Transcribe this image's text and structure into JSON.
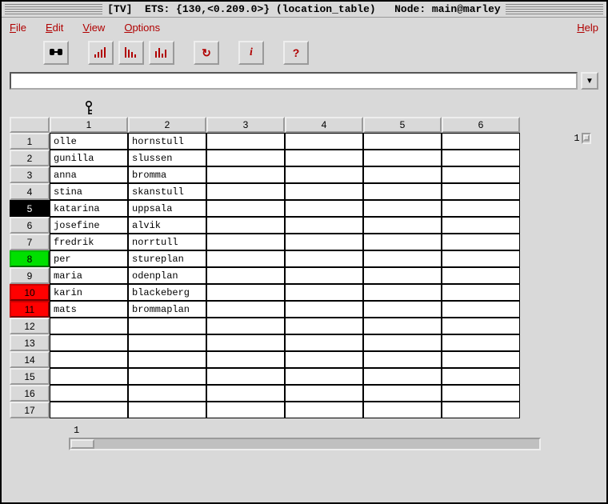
{
  "title": "[TV]  ETS: {130,<0.209.0>} (location_table)   Node: main@marley",
  "menu": {
    "file": "File",
    "edit": "Edit",
    "view": "View",
    "options": "Options",
    "help": "Help"
  },
  "toolbar": {
    "search": "search",
    "sort1": "sort-asc",
    "sort2": "sort-desc",
    "sort3": "sort-none",
    "refresh": "refresh",
    "info": "info",
    "question": "help"
  },
  "entry_value": "",
  "key_column_index": 1,
  "columns": [
    "1",
    "2",
    "3",
    "4",
    "5",
    "6"
  ],
  "rows": [
    {
      "n": "1",
      "style": "",
      "c": [
        "olle",
        "hornstull",
        "",
        "",
        "",
        ""
      ]
    },
    {
      "n": "2",
      "style": "",
      "c": [
        "gunilla",
        "slussen",
        "",
        "",
        "",
        ""
      ]
    },
    {
      "n": "3",
      "style": "",
      "c": [
        "anna",
        "bromma",
        "",
        "",
        "",
        ""
      ]
    },
    {
      "n": "4",
      "style": "",
      "c": [
        "stina",
        "skanstull",
        "",
        "",
        "",
        ""
      ]
    },
    {
      "n": "5",
      "style": "black",
      "c": [
        "katarina",
        "uppsala",
        "",
        "",
        "",
        ""
      ]
    },
    {
      "n": "6",
      "style": "",
      "c": [
        "josefine",
        "alvik",
        "",
        "",
        "",
        ""
      ]
    },
    {
      "n": "7",
      "style": "",
      "c": [
        "fredrik",
        "norrtull",
        "",
        "",
        "",
        ""
      ]
    },
    {
      "n": "8",
      "style": "green",
      "c": [
        "per",
        "stureplan",
        "",
        "",
        "",
        ""
      ]
    },
    {
      "n": "9",
      "style": "",
      "c": [
        "maria",
        "odenplan",
        "",
        "",
        "",
        ""
      ]
    },
    {
      "n": "10",
      "style": "red",
      "c": [
        "karin",
        "blackeberg",
        "",
        "",
        "",
        ""
      ]
    },
    {
      "n": "11",
      "style": "red",
      "c": [
        "mats",
        "brommaplan",
        "",
        "",
        "",
        ""
      ]
    },
    {
      "n": "12",
      "style": "",
      "c": [
        "",
        "",
        "",
        "",
        "",
        ""
      ]
    },
    {
      "n": "13",
      "style": "",
      "c": [
        "",
        "",
        "",
        "",
        "",
        ""
      ]
    },
    {
      "n": "14",
      "style": "",
      "c": [
        "",
        "",
        "",
        "",
        "",
        ""
      ]
    },
    {
      "n": "15",
      "style": "",
      "c": [
        "",
        "",
        "",
        "",
        "",
        ""
      ]
    },
    {
      "n": "16",
      "style": "",
      "c": [
        "",
        "",
        "",
        "",
        "",
        ""
      ]
    },
    {
      "n": "17",
      "style": "",
      "c": [
        "",
        "",
        "",
        "",
        "",
        ""
      ]
    }
  ],
  "hscroll_pos": "1",
  "vscroll_pos": "1"
}
